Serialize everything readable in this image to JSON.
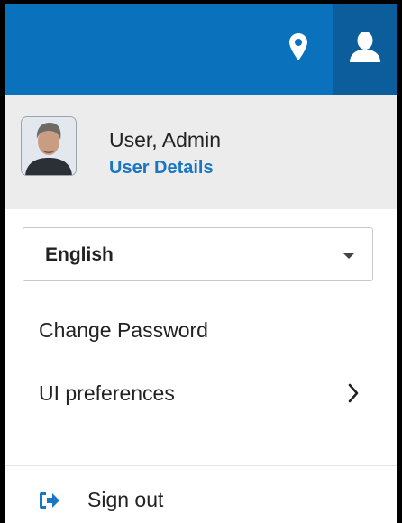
{
  "header": {
    "location_icon": "map-marker-icon",
    "user_icon": "user-icon",
    "accent_color": "#0a72bd",
    "active_color": "#0b5d9c"
  },
  "user": {
    "name": "User, Admin",
    "details_link": "User Details",
    "avatar": "avatar-photo"
  },
  "language": {
    "selected": "English"
  },
  "menu": {
    "change_password": "Change Password",
    "ui_preferences": "UI preferences"
  },
  "footer": {
    "sign_out": "Sign out",
    "sign_out_icon": "sign-out-icon"
  }
}
